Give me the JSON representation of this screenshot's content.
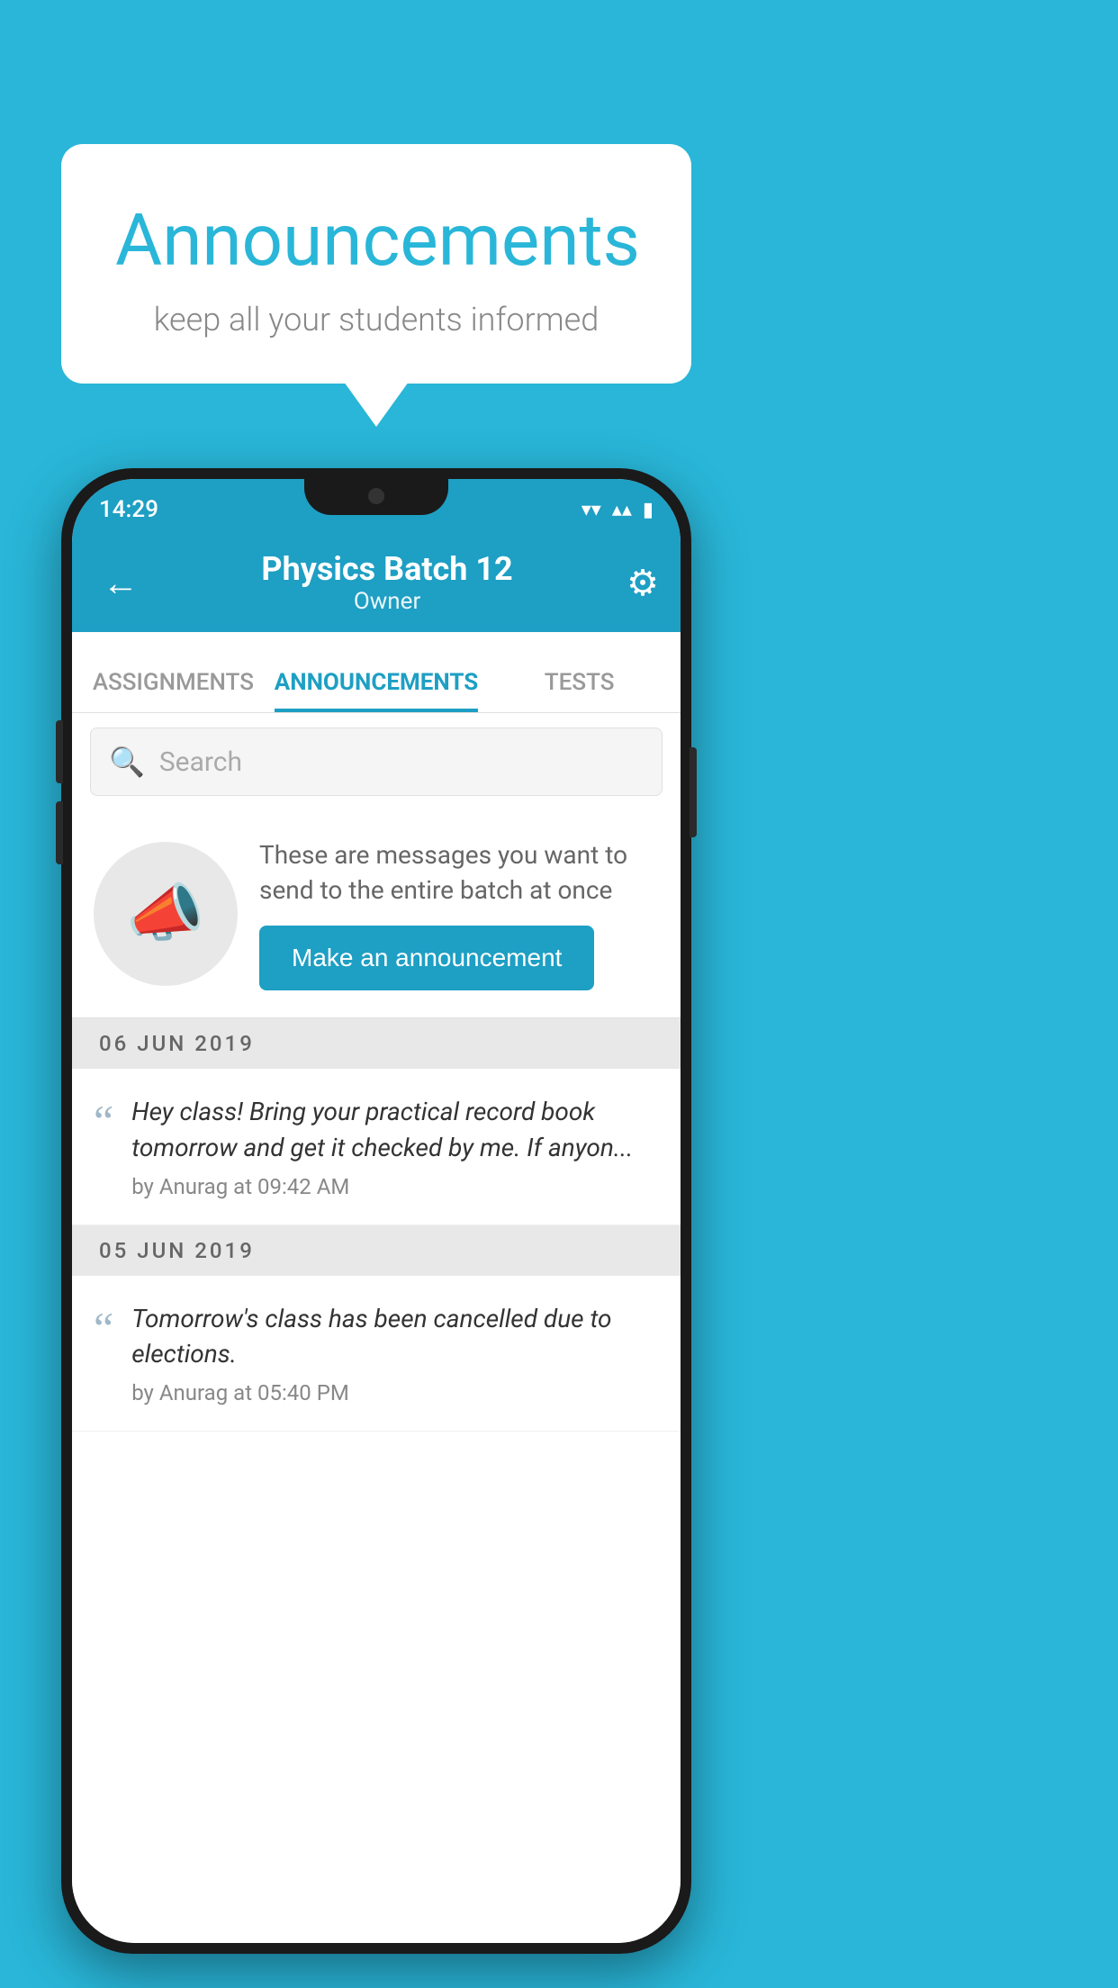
{
  "background_color": "#29b6d8",
  "speech_bubble": {
    "title": "Announcements",
    "subtitle": "keep all your students informed"
  },
  "phone": {
    "status_bar": {
      "time": "14:29",
      "wifi": "▾",
      "signal": "▴",
      "battery": "▮"
    },
    "app_bar": {
      "back_icon": "←",
      "title": "Physics Batch 12",
      "subtitle": "Owner",
      "settings_icon": "⚙"
    },
    "tabs": [
      {
        "label": "ASSIGNMENTS",
        "active": false
      },
      {
        "label": "ANNOUNCEMENTS",
        "active": true
      },
      {
        "label": "TESTS",
        "active": false
      }
    ],
    "search": {
      "placeholder": "Search",
      "icon": "🔍"
    },
    "announcement_prompt": {
      "description_text": "These are messages you want to send to the entire batch at once",
      "button_label": "Make an announcement"
    },
    "announcements": [
      {
        "date": "06  JUN  2019",
        "text": "Hey class! Bring your practical record book tomorrow and get it checked by me. If anyon...",
        "author": "by Anurag at 09:42 AM"
      },
      {
        "date": "05  JUN  2019",
        "text": "Tomorrow's class has been cancelled due to elections.",
        "author": "by Anurag at 05:40 PM"
      }
    ]
  }
}
